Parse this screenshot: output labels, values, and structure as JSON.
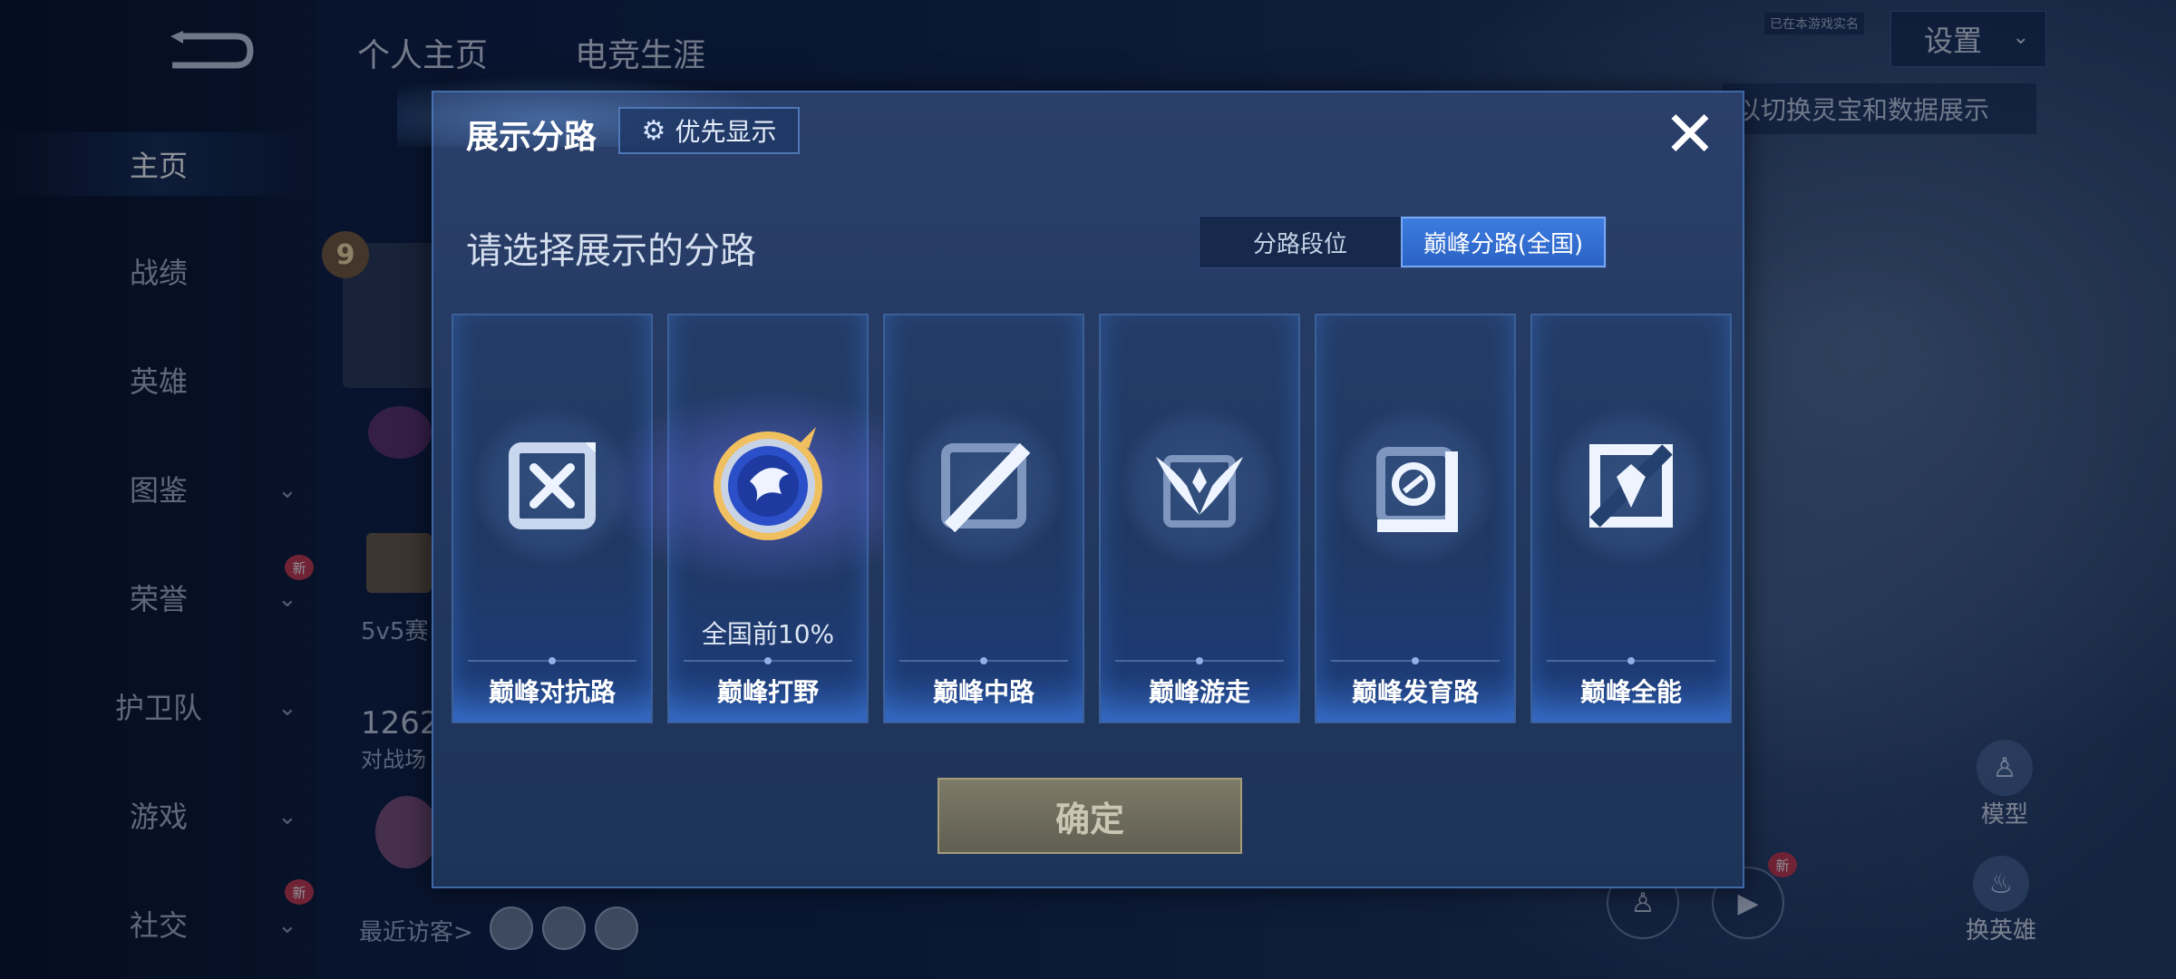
{
  "sidebar": {
    "items": [
      {
        "label": "主页"
      },
      {
        "label": "战绩"
      },
      {
        "label": "英雄"
      },
      {
        "label": "图鉴"
      },
      {
        "label": "荣誉"
      },
      {
        "label": "护卫队"
      },
      {
        "label": "游戏"
      },
      {
        "label": "社交"
      }
    ],
    "new_badge": "新"
  },
  "header": {
    "tabs": [
      "个人主页",
      "电竞生涯"
    ],
    "settings_label": "设置",
    "tiny_label": "已在本游戏实名",
    "hint": "以切换灵宝和数据展示"
  },
  "background": {
    "level": "9",
    "mode_text": "5v5赛",
    "count_number": "1262",
    "count_caption": "对战场",
    "visitors_label": "最近访客>"
  },
  "right_panel": {
    "model_label": "模型",
    "switch_hero_label": "换英雄",
    "new_badge": "新"
  },
  "dialog": {
    "title": "展示分路",
    "priority_button": "优先显示",
    "subtitle": "请选择展示的分路",
    "segment_options": [
      "分路段位",
      "巅峰分路(全国)"
    ],
    "segment_selected": "巅峰分路(全国)",
    "cards": [
      {
        "name": "巅峰对抗路",
        "icon": "crossed-swords-icon",
        "rank": ""
      },
      {
        "name": "巅峰打野",
        "icon": "dragon-emblem-icon",
        "rank": "全国前10%"
      },
      {
        "name": "巅峰中路",
        "icon": "staff-icon",
        "rank": ""
      },
      {
        "name": "巅峰游走",
        "icon": "wings-icon",
        "rank": ""
      },
      {
        "name": "巅峰发育路",
        "icon": "marksman-icon",
        "rank": ""
      },
      {
        "name": "巅峰全能",
        "icon": "all-round-icon",
        "rank": ""
      }
    ],
    "confirm_label": "确定"
  },
  "colors": {
    "dialog_bg": "#22375e",
    "accent_blue": "#3d7ce0",
    "confirm_gold": "#7d7a68"
  }
}
